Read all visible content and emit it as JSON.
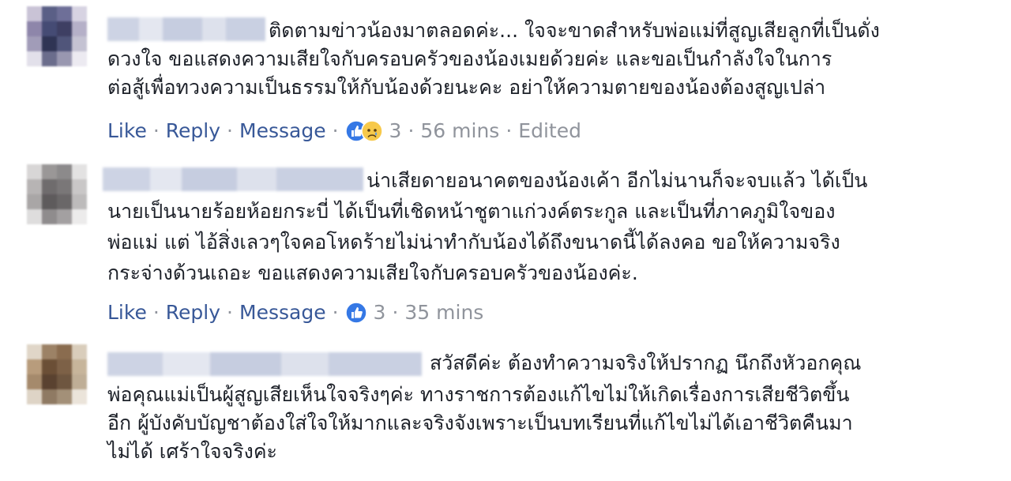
{
  "comments": [
    {
      "lines": [
        "ติดตามข่าวน้องมาตลอดค่ะ... ใจจะขาดสำหรับพ่อแม่ที่สูญเสียลูกที่เป็นดั่ง",
        "ดวงใจ ขอแสดงความเสียใจกับครอบครัวของน้องเมยด้วยค่ะ และขอเป็นกำลังใจในการ",
        "ต่อสู้เพื่อทวงความเป็นธรรมให้กับน้องด้วยนะคะ อย่าให้ความตายของน้องต้องสูญเปล่า"
      ],
      "like_label": "Like",
      "reply_label": "Reply",
      "message_label": "Message",
      "reaction_icons": [
        "like-icon",
        "sad-icon"
      ],
      "reaction_count": "3",
      "time": "56 mins",
      "edited": "Edited"
    },
    {
      "lines": [
        "น่าเสียดายอนาคตของน้องเค้า อีกไม่นานก็จะจบแล้ว ได้เป็น",
        "นายเป็นนายร้อยห้อยกระบี่ ได้เป็นที่เชิดหน้าชูตาแก่วงค์ตระกูล และเป็นที่ภาคภูมิใจของ",
        "พ่อแม่ แต่ ไอ้สิ่งเลวๆใจคอโหดร้ายไม่น่าทำกับน้องได้ถึงขนาดนี้ได้ลงคอ ขอให้ความจริง",
        "กระจ่างด้วนเถอะ ขอแสดงความเสียใจกับครอบครัวของน้องค่ะ."
      ],
      "like_label": "Like",
      "reply_label": "Reply",
      "message_label": "Message",
      "reaction_icons": [
        "like-icon"
      ],
      "reaction_count": "3",
      "time": "35 mins"
    },
    {
      "lines": [
        "สวัสดีค่ะ ต้องทำความจริงให้ปรากฏ นึกถึงหัวอกคุณ",
        "พ่อคุณแม่เป็นผู้สูญเสียเห็นใจจริงๆค่ะ ทางราชการต้องแก้ไขไม่ให้เกิดเรื่องการเสียชีวิตขึ้น",
        "อีก ผู้บังคับบัญชาต้องใส่ใจให้มากและจริงจังเพราะเป็นบทเรียนที่แก้ไขไม่ได้เอาชีวิตคืนมา",
        "ไม่ได้ เศร้าใจจริงค่ะ"
      ]
    }
  ],
  "colors": {
    "text": "#1d2129",
    "action": "#385898",
    "meta": "#90949c",
    "like_blue": "#3578e5",
    "sad_yellow": "#f7c94b"
  }
}
